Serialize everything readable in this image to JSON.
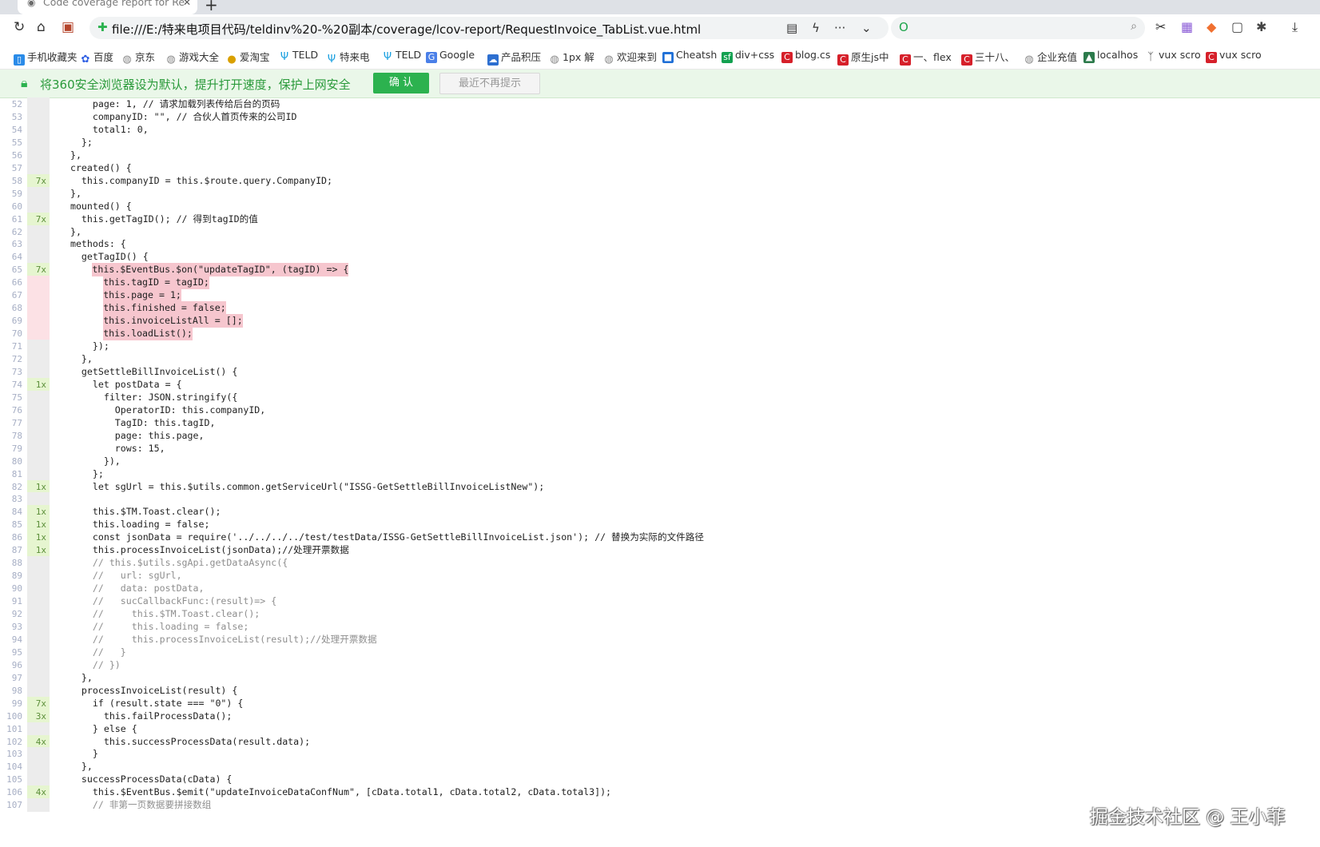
{
  "tab": {
    "title": "Code coverage report for RequestInvoice_TabList.vue"
  },
  "address_bar": {
    "url": "file:///E:/特来电项目代码/teldinv%20-%20副本/coverage/lcov-report/RequestInvoice_TabList.vue.html",
    "search_value": ""
  },
  "bookmarks": [
    {
      "label": "手机收藏夹",
      "icon": "phone-icon",
      "color": "#2a8be8"
    },
    {
      "label": "百度",
      "icon": "baidu-paw-icon",
      "color": "#2f5fe3"
    },
    {
      "label": "京东",
      "icon": "globe-icon",
      "color": "#888888"
    },
    {
      "label": "游戏大全",
      "icon": "globe-icon",
      "color": "#888888"
    },
    {
      "label": "爱淘宝",
      "icon": "taobao-icon",
      "color": "#d9a000"
    },
    {
      "label": "TELD",
      "icon": "teld-icon",
      "color": "#1aa0e0"
    },
    {
      "label": "特来电",
      "icon": "teld-icon",
      "color": "#1aa0e0"
    },
    {
      "label": "TELD",
      "icon": "teld-icon",
      "color": "#1aa0e0"
    },
    {
      "label": "Google",
      "icon": "translate-icon",
      "color": "#4a7fe8"
    },
    {
      "label": "产品积压",
      "icon": "cloud-icon",
      "color": "#2d6fd0"
    },
    {
      "label": "1px 解",
      "icon": "globe-icon",
      "color": "#888888"
    },
    {
      "label": "欢迎来到",
      "icon": "globe-icon",
      "color": "#888888"
    },
    {
      "label": "Cheatsh",
      "icon": "bookmark-icon",
      "color": "#1f6fd6"
    },
    {
      "label": "div+css",
      "icon": "sf-icon",
      "color": "#12a150"
    },
    {
      "label": "blog.cs",
      "icon": "csdn-icon",
      "color": "#d6202a"
    },
    {
      "label": "原生js中",
      "icon": "csdn-icon",
      "color": "#d6202a"
    },
    {
      "label": "一、flex",
      "icon": "csdn-icon",
      "color": "#d6202a"
    },
    {
      "label": "三十八、",
      "icon": "csdn-icon",
      "color": "#d6202a"
    },
    {
      "label": "企业充值",
      "icon": "globe-icon",
      "color": "#888888"
    },
    {
      "label": "localhos",
      "icon": "vue-icon",
      "color": "#2c7a4b"
    },
    {
      "label": "vux scro",
      "icon": "vux-icon",
      "color": "#444444"
    },
    {
      "label": "vux scro",
      "icon": "csdn-icon",
      "color": "#d6202a"
    }
  ],
  "notification": {
    "text": "将360安全浏览器设为默认，提升打开速度，保护上网安全",
    "confirm_label": "确 认",
    "dismiss_label": "最近不再提示"
  },
  "code_lines": [
    {
      "n": "52",
      "hit": "",
      "code": "      page: 1, // 请求加载列表传给后台的页码"
    },
    {
      "n": "53",
      "hit": "",
      "code": "      companyID: \"\", // 合伙人首页传来的公司ID"
    },
    {
      "n": "54",
      "hit": "",
      "code": "      total1: 0,"
    },
    {
      "n": "55",
      "hit": "",
      "code": "    };"
    },
    {
      "n": "56",
      "hit": "",
      "code": "  },"
    },
    {
      "n": "57",
      "hit": "",
      "code": "  created() {"
    },
    {
      "n": "58",
      "hit": "7x",
      "code": "    this.companyID = this.$route.query.CompanyID;"
    },
    {
      "n": "59",
      "hit": "",
      "code": "  },"
    },
    {
      "n": "60",
      "hit": "",
      "code": "  mounted() {"
    },
    {
      "n": "61",
      "hit": "7x",
      "code": "    this.getTagID(); // 得到tagID的值"
    },
    {
      "n": "62",
      "hit": "",
      "code": "  },"
    },
    {
      "n": "63",
      "hit": "",
      "code": "  methods: {"
    },
    {
      "n": "64",
      "hit": "",
      "code": "    getTagID() {"
    },
    {
      "n": "65",
      "hit": "7x",
      "code": "      this.$EventBus.$on(\"updateTagID\", (tagID) => {",
      "miss": true,
      "pre": 6
    },
    {
      "n": "66",
      "hit": "",
      "code": "        this.tagID = tagID;",
      "miss": true,
      "pre": 8
    },
    {
      "n": "67",
      "hit": "",
      "code": "        this.page = 1;",
      "miss": true,
      "pre": 8
    },
    {
      "n": "68",
      "hit": "",
      "code": "        this.finished = false;",
      "miss": true,
      "pre": 8
    },
    {
      "n": "69",
      "hit": "",
      "code": "        this.invoiceListAll = [];",
      "miss": true,
      "pre": 8
    },
    {
      "n": "70",
      "hit": "",
      "code": "        this.loadList();",
      "miss": true,
      "pre": 8
    },
    {
      "n": "71",
      "hit": "",
      "code": "      });"
    },
    {
      "n": "72",
      "hit": "",
      "code": "    },"
    },
    {
      "n": "73",
      "hit": "",
      "code": "    getSettleBillInvoiceList() {"
    },
    {
      "n": "74",
      "hit": "1x",
      "code": "      let postData = {"
    },
    {
      "n": "75",
      "hit": "",
      "code": "        filter: JSON.stringify({"
    },
    {
      "n": "76",
      "hit": "",
      "code": "          OperatorID: this.companyID,"
    },
    {
      "n": "77",
      "hit": "",
      "code": "          TagID: this.tagID,"
    },
    {
      "n": "78",
      "hit": "",
      "code": "          page: this.page,"
    },
    {
      "n": "79",
      "hit": "",
      "code": "          rows: 15,"
    },
    {
      "n": "80",
      "hit": "",
      "code": "        }),"
    },
    {
      "n": "81",
      "hit": "",
      "code": "      };"
    },
    {
      "n": "82",
      "hit": "1x",
      "code": "      let sgUrl = this.$utils.common.getServiceUrl(\"ISSG-GetSettleBillInvoiceListNew\");"
    },
    {
      "n": "83",
      "hit": "",
      "code": ""
    },
    {
      "n": "84",
      "hit": "1x",
      "code": "      this.$TM.Toast.clear();"
    },
    {
      "n": "85",
      "hit": "1x",
      "code": "      this.loading = false;"
    },
    {
      "n": "86",
      "hit": "1x",
      "code": "      const jsonData = require('../../../../test/testData/ISSG-GetSettleBillInvoiceList.json'); // 替换为实际的文件路径"
    },
    {
      "n": "87",
      "hit": "1x",
      "code": "      this.processInvoiceList(jsonData);//处理开票数据"
    },
    {
      "n": "88",
      "hit": "",
      "code": "      // this.$utils.sgApi.getDataAsync({",
      "comment": true
    },
    {
      "n": "89",
      "hit": "",
      "code": "      //   url: sgUrl,",
      "comment": true
    },
    {
      "n": "90",
      "hit": "",
      "code": "      //   data: postData,",
      "comment": true
    },
    {
      "n": "91",
      "hit": "",
      "code": "      //   sucCallbackFunc:(result)=> {",
      "comment": true
    },
    {
      "n": "92",
      "hit": "",
      "code": "      //     this.$TM.Toast.clear();",
      "comment": true
    },
    {
      "n": "93",
      "hit": "",
      "code": "      //     this.loading = false;",
      "comment": true
    },
    {
      "n": "94",
      "hit": "",
      "code": "      //     this.processInvoiceList(result);//处理开票数据",
      "comment": true
    },
    {
      "n": "95",
      "hit": "",
      "code": "      //   }",
      "comment": true
    },
    {
      "n": "96",
      "hit": "",
      "code": "      // })",
      "comment": true
    },
    {
      "n": "97",
      "hit": "",
      "code": "    },"
    },
    {
      "n": "98",
      "hit": "",
      "code": "    processInvoiceList(result) {"
    },
    {
      "n": "99",
      "hit": "7x",
      "code": "      if (result.state === \"0\") {"
    },
    {
      "n": "100",
      "hit": "3x",
      "code": "        this.failProcessData();"
    },
    {
      "n": "101",
      "hit": "",
      "code": "      } else {"
    },
    {
      "n": "102",
      "hit": "4x",
      "code": "        this.successProcessData(result.data);"
    },
    {
      "n": "103",
      "hit": "",
      "code": "      }"
    },
    {
      "n": "104",
      "hit": "",
      "code": "    },"
    },
    {
      "n": "105",
      "hit": "",
      "code": "    successProcessData(cData) {"
    },
    {
      "n": "106",
      "hit": "4x",
      "code": "      this.$EventBus.$emit(\"updateInvoiceDataConfNum\", [cData.total1, cData.total2, cData.total3]);"
    },
    {
      "n": "107",
      "hit": "",
      "code": "      // 非第一页数据要拼接数组",
      "comment": true
    }
  ],
  "watermark": "掘金技术社区 @ 王小菲"
}
